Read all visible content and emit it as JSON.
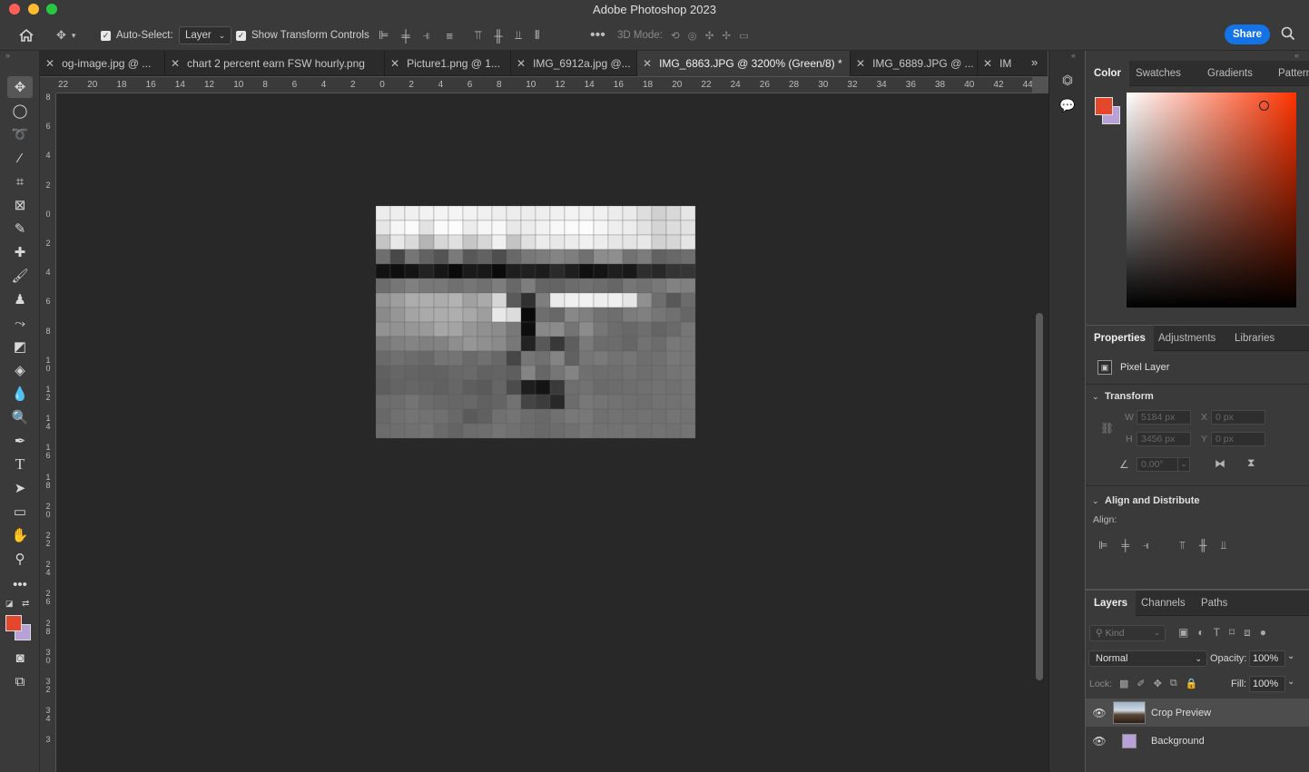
{
  "window": {
    "title": "Adobe Photoshop 2023"
  },
  "options_bar": {
    "auto_select_label": "Auto-Select:",
    "auto_select_value": "Layer",
    "show_transform_label": "Show Transform Controls",
    "mode_3d_label": "3D Mode:",
    "share_label": "Share"
  },
  "tabs": [
    {
      "label": "og-image.jpg @ ..."
    },
    {
      "label": "chart 2 percent earn FSW hourly.png"
    },
    {
      "label": "Picture1.png @ 1..."
    },
    {
      "label": "IMG_6912a.jpg @..."
    },
    {
      "label": "IMG_6863.JPG @ 3200% (Green/8) *"
    },
    {
      "label": "IMG_6889.JPG @ ..."
    },
    {
      "label": "IM"
    }
  ],
  "ruler": {
    "h_labels": [
      "22",
      "20",
      "18",
      "16",
      "14",
      "12",
      "10",
      "8",
      "6",
      "4",
      "2",
      "0",
      "2",
      "4",
      "6",
      "8",
      "10",
      "12",
      "14",
      "16",
      "18",
      "20",
      "22",
      "24",
      "26",
      "28",
      "30",
      "32",
      "34",
      "36",
      "38",
      "40",
      "42",
      "44"
    ],
    "v_labels": [
      "8",
      "6",
      "4",
      "2",
      "0",
      "2",
      "4",
      "6",
      "8",
      "10",
      "12",
      "14",
      "16",
      "18",
      "20",
      "22",
      "24",
      "26",
      "28",
      "30",
      "32",
      "34",
      "3"
    ]
  },
  "image_pixels": {
    "cols": 22,
    "rows": 16,
    "grays": [
      [
        236,
        238,
        240,
        242,
        244,
        244,
        242,
        240,
        238,
        236,
        236,
        238,
        240,
        242,
        242,
        240,
        236,
        234,
        222,
        208,
        216,
        230
      ],
      [
        230,
        246,
        250,
        226,
        250,
        252,
        236,
        246,
        248,
        232,
        236,
        242,
        248,
        250,
        252,
        246,
        238,
        236,
        226,
        212,
        220,
        226
      ],
      [
        196,
        232,
        218,
        180,
        214,
        224,
        198,
        214,
        240,
        196,
        224,
        236,
        232,
        236,
        240,
        236,
        230,
        228,
        232,
        210,
        214,
        228
      ],
      [
        110,
        72,
        118,
        98,
        84,
        122,
        88,
        98,
        78,
        104,
        120,
        124,
        132,
        126,
        112,
        140,
        142,
        114,
        124,
        98,
        104,
        110
      ],
      [
        18,
        14,
        20,
        34,
        22,
        10,
        26,
        24,
        10,
        30,
        32,
        28,
        42,
        30,
        16,
        20,
        30,
        24,
        46,
        40,
        52,
        54
      ],
      [
        108,
        118,
        128,
        120,
        120,
        112,
        118,
        112,
        126,
        104,
        126,
        100,
        100,
        108,
        112,
        108,
        102,
        118,
        112,
        120,
        130,
        128
      ],
      [
        148,
        158,
        172,
        174,
        172,
        178,
        160,
        170,
        214,
        90,
        48,
        126,
        234,
        240,
        242,
        238,
        240,
        230,
        144,
        110,
        88,
        108
      ],
      [
        138,
        150,
        164,
        170,
        172,
        174,
        168,
        158,
        232,
        220,
        10,
        110,
        104,
        136,
        128,
        114,
        110,
        124,
        128,
        118,
        112,
        102
      ],
      [
        146,
        146,
        150,
        154,
        166,
        164,
        150,
        144,
        140,
        120,
        14,
        136,
        140,
        116,
        140,
        118,
        108,
        104,
        110,
        100,
        106,
        118
      ],
      [
        120,
        128,
        132,
        128,
        130,
        142,
        150,
        144,
        138,
        120,
        34,
        88,
        56,
        94,
        122,
        108,
        108,
        102,
        114,
        108,
        120,
        118
      ],
      [
        106,
        112,
        108,
        104,
        116,
        116,
        106,
        112,
        104,
        70,
        118,
        112,
        132,
        96,
        118,
        122,
        114,
        118,
        110,
        112,
        120,
        118
      ],
      [
        96,
        102,
        100,
        98,
        98,
        104,
        106,
        98,
        100,
        94,
        132,
        102,
        118,
        132,
        112,
        110,
        110,
        114,
        110,
        112,
        116,
        118
      ],
      [
        94,
        100,
        102,
        100,
        96,
        102,
        94,
        90,
        102,
        76,
        30,
        20,
        58,
        110,
        114,
        106,
        108,
        110,
        112,
        114,
        112,
        116
      ],
      [
        108,
        110,
        116,
        108,
        104,
        102,
        104,
        96,
        100,
        114,
        68,
        60,
        40,
        108,
        120,
        116,
        114,
        112,
        110,
        114,
        114,
        116
      ],
      [
        104,
        112,
        116,
        114,
        112,
        104,
        90,
        96,
        112,
        116,
        108,
        104,
        112,
        120,
        120,
        112,
        114,
        112,
        114,
        112,
        116,
        114
      ],
      [
        108,
        110,
        112,
        116,
        106,
        100,
        108,
        110,
        116,
        112,
        108,
        104,
        108,
        112,
        118,
        114,
        114,
        116,
        112,
        114,
        112,
        116
      ]
    ]
  },
  "color_panel": {
    "tabs": [
      "Color",
      "Swatches",
      "Gradients",
      "Patterns"
    ],
    "foreground": "#e4472b",
    "background": "#b8a1d6",
    "hue_color": "#ff3300"
  },
  "properties_panel": {
    "tabs": [
      "Properties",
      "Adjustments",
      "Libraries"
    ],
    "layer_type": "Pixel Layer",
    "transform_title": "Transform",
    "w_label": "W",
    "w_value": "5184 px",
    "h_label": "H",
    "h_value": "3456 px",
    "x_label": "X",
    "x_value": "0 px",
    "y_label": "Y",
    "y_value": "0 px",
    "angle_value": "0.00°",
    "align_title": "Align and Distribute",
    "align_label": "Align:"
  },
  "layers_panel": {
    "tabs": [
      "Layers",
      "Channels",
      "Paths"
    ],
    "kind_placeholder": "Kind",
    "blend_mode": "Normal",
    "opacity_label": "Opacity:",
    "opacity_value": "100%",
    "lock_label": "Lock:",
    "fill_label": "Fill:",
    "fill_value": "100%",
    "layers": [
      {
        "name": "Crop Preview",
        "selected": true
      },
      {
        "name": "Background",
        "selected": false
      }
    ]
  }
}
